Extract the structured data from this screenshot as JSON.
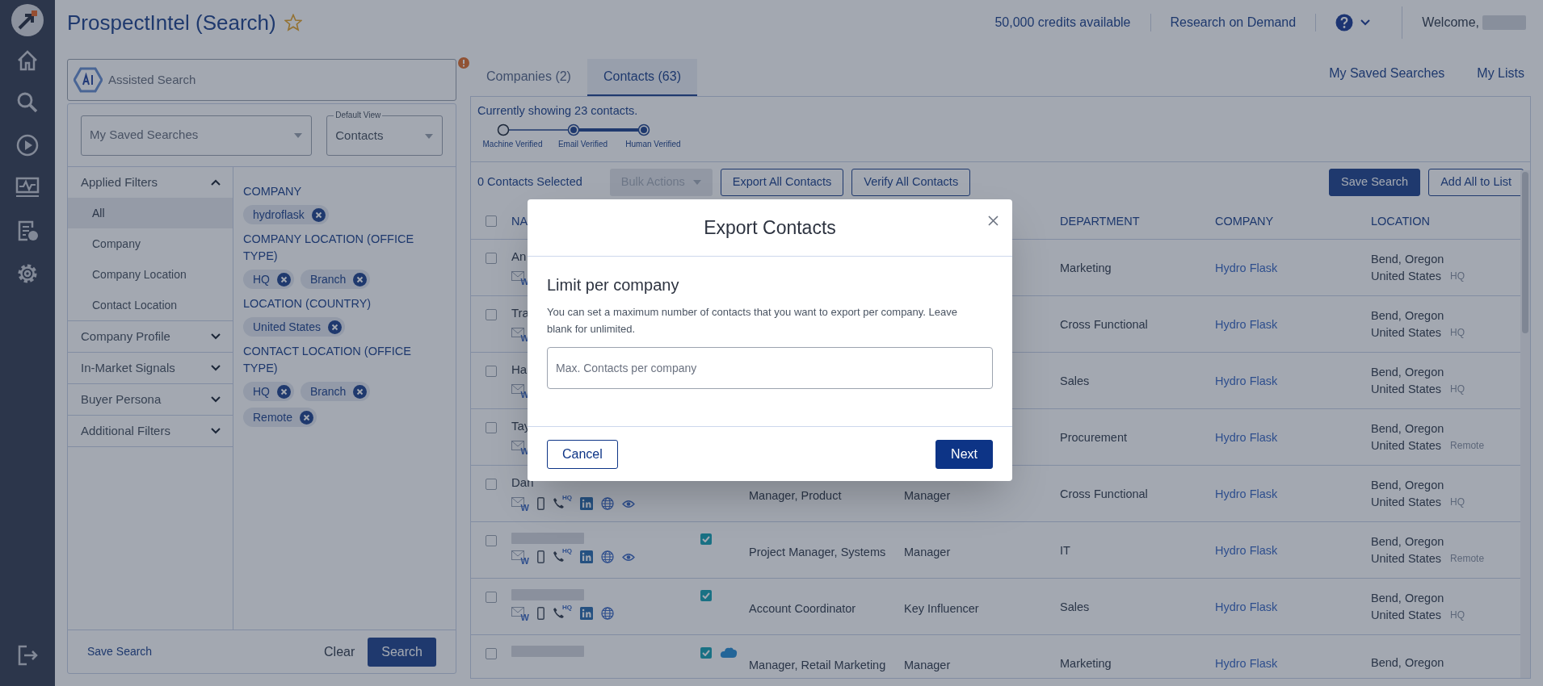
{
  "header": {
    "title": "ProspectIntel (Search)",
    "favorite": false,
    "credits": "50,000 credits available",
    "research_link": "Research on Demand",
    "welcome": "Welcome,",
    "user_redacted": true
  },
  "assisted_search": {
    "placeholder": "Assisted Search",
    "alert": true
  },
  "filters": {
    "saved_searches": {
      "placeholder": "My Saved Searches"
    },
    "default_view": {
      "label": "Default View",
      "value": "Contacts"
    },
    "sections": [
      {
        "label": "Applied Filters",
        "expanded": true,
        "children": [
          {
            "label": "All",
            "selected": true
          },
          {
            "label": "Company",
            "selected": false
          },
          {
            "label": "Company Location",
            "selected": false
          },
          {
            "label": "Contact Location",
            "selected": false
          }
        ]
      },
      {
        "label": "Company Profile",
        "expanded": false
      },
      {
        "label": "In-Market Signals",
        "expanded": false
      },
      {
        "label": "Buyer Persona",
        "expanded": false
      },
      {
        "label": "Additional Filters",
        "expanded": false
      }
    ],
    "groups": [
      {
        "title": "COMPANY",
        "tags": [
          "hydroflask"
        ]
      },
      {
        "title": "COMPANY LOCATION (OFFICE TYPE)",
        "tags": [
          "HQ",
          "Branch"
        ]
      },
      {
        "title": "LOCATION (COUNTRY)",
        "tags": [
          "United States"
        ]
      },
      {
        "title": "CONTACT LOCATION (OFFICE TYPE)",
        "tags": [
          "HQ",
          "Branch",
          "Remote"
        ]
      }
    ],
    "footer": {
      "save": "Save Search",
      "clear": "Clear",
      "search": "Search"
    }
  },
  "tabs": [
    {
      "label": "Companies (2)",
      "selected": false
    },
    {
      "label": "Contacts (63)",
      "selected": true
    }
  ],
  "tab_links": [
    "My Saved Searches",
    "My Lists"
  ],
  "results": {
    "summary": "Currently showing 23 contacts.",
    "verification_steps": [
      {
        "label": "Machine Verified",
        "on": false
      },
      {
        "label": "Email Verified",
        "on": true
      },
      {
        "label": "Human Verified",
        "on": true
      }
    ],
    "selected_count": "0 Contacts Selected",
    "bulk_actions": {
      "label": "Bulk Actions",
      "disabled": true
    },
    "toolbar_left": [
      {
        "label": "Export All Contacts",
        "kind": "outline"
      },
      {
        "label": "Verify All Contacts",
        "kind": "outline"
      }
    ],
    "toolbar_right": [
      {
        "label": "Save Search",
        "kind": "primary"
      },
      {
        "label": "Add All to List",
        "kind": "outline"
      }
    ]
  },
  "table": {
    "select_all_checked": false,
    "columns": [
      {
        "label": "NA"
      },
      {
        "label": "DEPARTMENT"
      },
      {
        "label": "COMPANY"
      },
      {
        "label": "LOCATION"
      }
    ],
    "rows": [
      {
        "checked": false,
        "name": "An",
        "icons": [
          {
            "kind": "email",
            "badge": "W"
          }
        ],
        "department": "Marketing",
        "company": "Hydro Flask",
        "city": "Bend, Oregon",
        "country": "United States",
        "office": "HQ"
      },
      {
        "checked": false,
        "name": "Tra",
        "icons": [
          {
            "kind": "email",
            "badge": "W"
          }
        ],
        "department": "Cross Functional",
        "company": "Hydro Flask",
        "city": "Bend, Oregon",
        "country": "United States",
        "office": "HQ"
      },
      {
        "checked": false,
        "name": "Ha",
        "icons": [
          {
            "kind": "email",
            "badge": "W"
          }
        ],
        "department": "Sales",
        "company": "Hydro Flask",
        "city": "Bend, Oregon",
        "country": "United States",
        "office": "HQ"
      },
      {
        "checked": false,
        "name": "Tay",
        "icons": [
          {
            "kind": "email",
            "badge": "W"
          }
        ],
        "department": "Procurement",
        "company": "Hydro Flask",
        "city": "Bend, Oregon",
        "country": "United States",
        "office": "Remote"
      },
      {
        "checked": false,
        "name": "Dan",
        "icons": [
          {
            "kind": "email",
            "badge": "W"
          },
          {
            "kind": "mobile"
          },
          {
            "kind": "phone",
            "badge": "HQ"
          },
          {
            "kind": "linkedin"
          },
          {
            "kind": "web"
          },
          {
            "kind": "eye"
          }
        ],
        "title": "Manager, Product",
        "level": "Manager",
        "department": "Cross Functional",
        "company": "Hydro Flask",
        "city": "Bend, Oregon",
        "country": "United States",
        "office": "HQ"
      },
      {
        "checked": false,
        "redacted": true,
        "icons": [
          {
            "kind": "email",
            "badge": "W"
          },
          {
            "kind": "mobile"
          },
          {
            "kind": "phone",
            "badge": "HQ"
          },
          {
            "kind": "linkedin"
          },
          {
            "kind": "web"
          },
          {
            "kind": "eye"
          }
        ],
        "verified": true,
        "title": "Project Manager, Systems",
        "level": "Manager",
        "department": "IT",
        "company": "Hydro Flask",
        "city": "Bend, Oregon",
        "country": "United States",
        "office": "Remote"
      },
      {
        "checked": false,
        "redacted": true,
        "icons": [
          {
            "kind": "email",
            "badge": "W"
          },
          {
            "kind": "mobile"
          },
          {
            "kind": "phone",
            "badge": "HQ"
          },
          {
            "kind": "linkedin"
          },
          {
            "kind": "web"
          }
        ],
        "verified": true,
        "title": "Account Coordinator",
        "level": "Key Influencer",
        "department": "Sales",
        "company": "Hydro Flask",
        "city": "Bend, Oregon",
        "country": "United States",
        "office": "HQ"
      },
      {
        "checked": false,
        "redacted": true,
        "icons": [],
        "verified": true,
        "crm": true,
        "title": "Manager, Retail Marketing",
        "level": "Manager",
        "department": "Marketing",
        "company": "Hydro Flask",
        "city": "Bend, Oregon"
      }
    ]
  },
  "modal": {
    "title": "Export Contacts",
    "heading": "Limit per company",
    "description": "You can set a maximum number of contacts that you want to export per company. Leave blank for unlimited.",
    "input": {
      "placeholder": "Max. Contacts per company"
    },
    "buttons": [
      {
        "label": "Cancel",
        "kind": "secondary"
      },
      {
        "label": "Next",
        "kind": "primary"
      }
    ]
  }
}
